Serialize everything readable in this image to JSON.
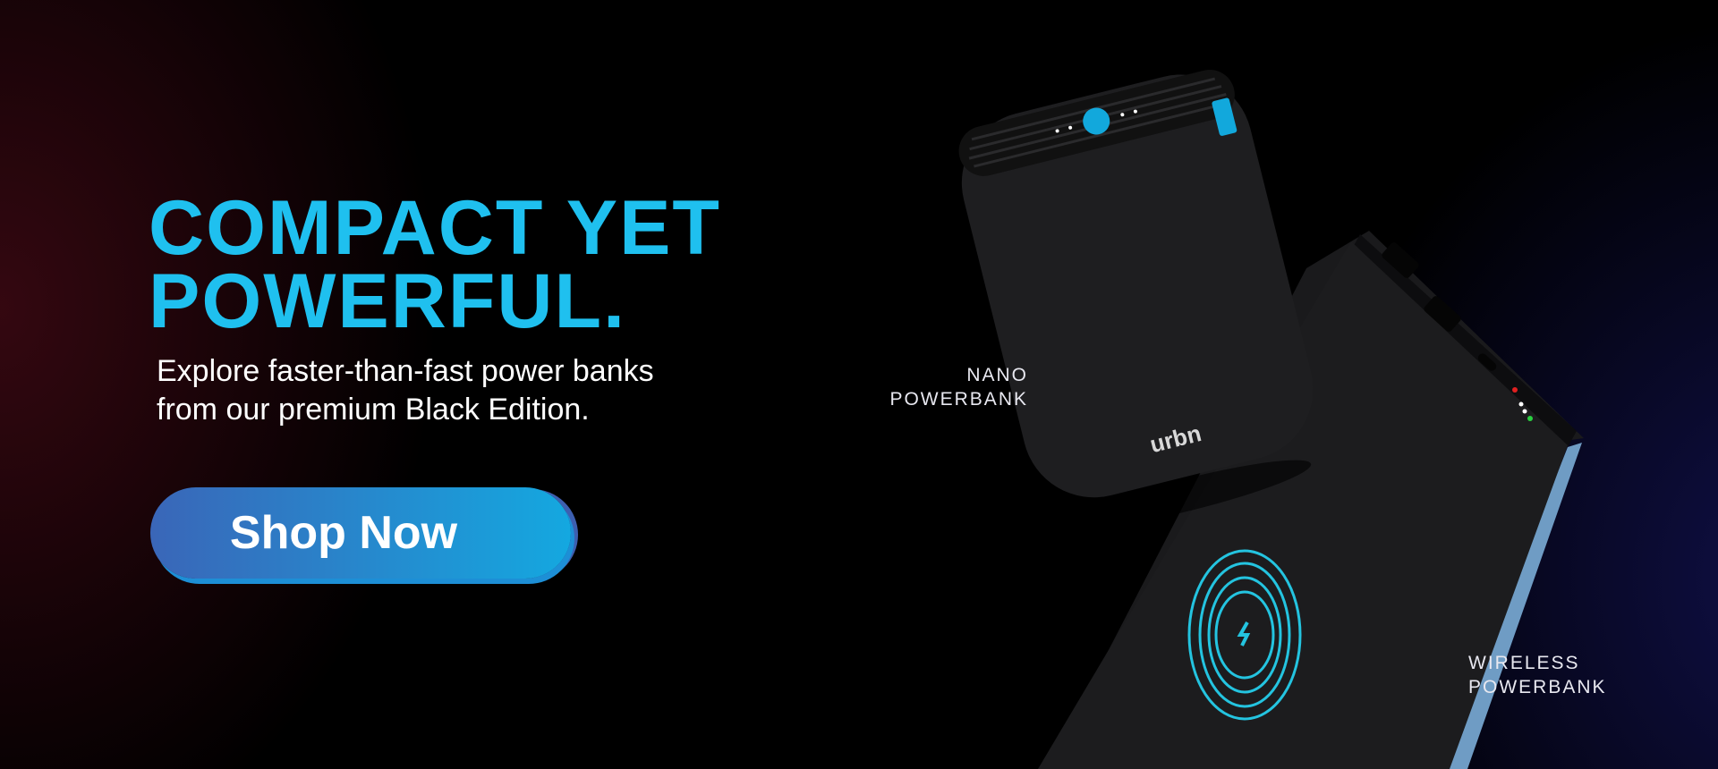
{
  "hero": {
    "headline_line1": "COMPACT YET",
    "headline_line2": "POWERFUL.",
    "subtitle_line1": "Explore faster-than-fast power banks",
    "subtitle_line2": "from our premium Black Edition.",
    "cta_label": "Shop Now"
  },
  "products": {
    "nano_line1": "NANO",
    "nano_line2": "POWERBANK",
    "wireless_line1": "WIRELESS",
    "wireless_line2": "POWERBANK",
    "brand_logo": "urbn"
  },
  "colors": {
    "accent": "#1fc0ef",
    "button_start": "#3a66b8",
    "button_end": "#14a8e0"
  }
}
